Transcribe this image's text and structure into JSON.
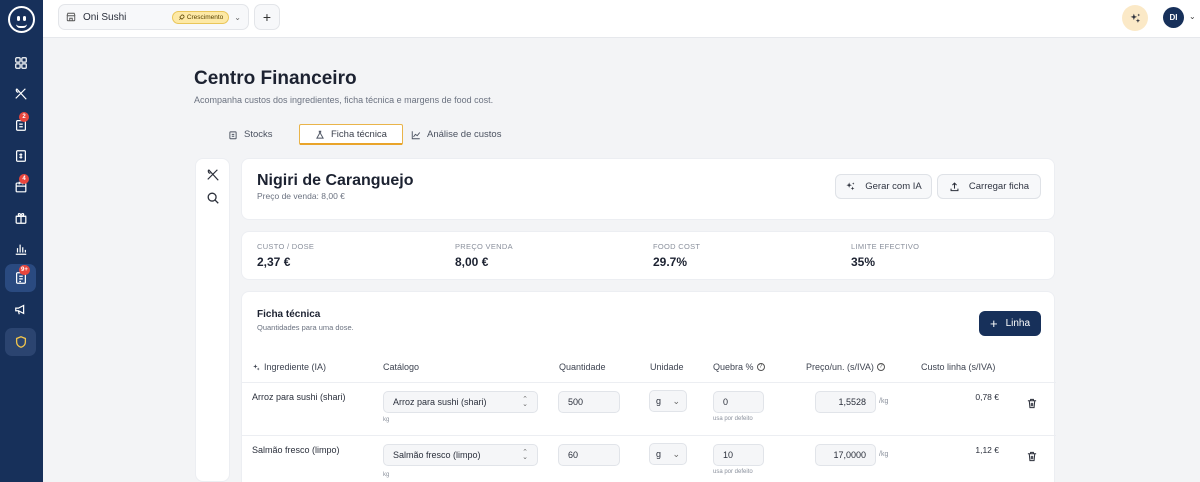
{
  "sidebar": {
    "items": [
      {
        "name": "dashboard-icon",
        "badge": ""
      },
      {
        "name": "utensils-icon",
        "badge": ""
      },
      {
        "name": "orders-icon",
        "badge": "2"
      },
      {
        "name": "menu-icon",
        "badge": ""
      },
      {
        "name": "calendar-icon",
        "badge": "4"
      },
      {
        "name": "gift-icon",
        "badge": ""
      },
      {
        "name": "bar-chart-icon",
        "badge": ""
      },
      {
        "name": "finance-icon",
        "badge": "9+"
      },
      {
        "name": "megaphone-icon",
        "badge": ""
      },
      {
        "name": "shield-icon",
        "badge": ""
      }
    ]
  },
  "topbar": {
    "restaurant_name": "Oni Sushi",
    "plan_badge": "Crescimento",
    "avatar_initials": "DI"
  },
  "page": {
    "title": "Centro Financeiro",
    "subtitle": "Acompanha custos dos ingredientes, ficha técnica e margens de food cost."
  },
  "tabs": [
    {
      "label": "Stocks",
      "icon": "clipboard-icon"
    },
    {
      "label": "Ficha técnica",
      "icon": "flask-icon",
      "active": true
    },
    {
      "label": "Análise de custos",
      "icon": "line-chart-icon"
    }
  ],
  "dish": {
    "name": "Nigiri de Caranguejo",
    "price_line": "Preço de venda: 8,00 €",
    "btn_generate": "Gerar com IA",
    "btn_upload": "Carregar ficha"
  },
  "kpis": [
    {
      "label": "CUSTO / DOSE",
      "value": "2,37 €"
    },
    {
      "label": "PREÇO VENDA",
      "value": "8,00 €"
    },
    {
      "label": "FOOD COST",
      "value": "29.7%"
    },
    {
      "label": "LIMITE EFECTIVO",
      "value": "35%"
    }
  ],
  "sheet": {
    "title": "Ficha técnica",
    "subtitle": "Quantidades para uma dose.",
    "add_button": "Linha",
    "headers": {
      "ingredient": "Ingrediente (IA)",
      "catalog": "Catálogo",
      "quantity": "Quantidade",
      "unit": "Unidade",
      "waste": "Quebra %",
      "price": "Preço/un. (s/IVA)",
      "line_cost": "Custo linha (s/IVA)"
    },
    "rows": [
      {
        "ingredient": "Arroz para sushi (shari)",
        "catalog": "Arroz para sushi (shari)",
        "catalog_unit": "kg",
        "quantity": "500",
        "unit": "g",
        "waste": "0",
        "waste_note": "usa por defeito",
        "price": "1,5528",
        "price_unit": "/kg",
        "line_cost": "0,78 €"
      },
      {
        "ingredient": "Salmão fresco (limpo)",
        "catalog": "Salmão fresco (limpo)",
        "catalog_unit": "kg",
        "quantity": "60",
        "unit": "g",
        "waste": "10",
        "waste_note": "usa por defeito",
        "price": "17,0000",
        "price_unit": "/kg",
        "line_cost": "1,12 €"
      }
    ]
  }
}
